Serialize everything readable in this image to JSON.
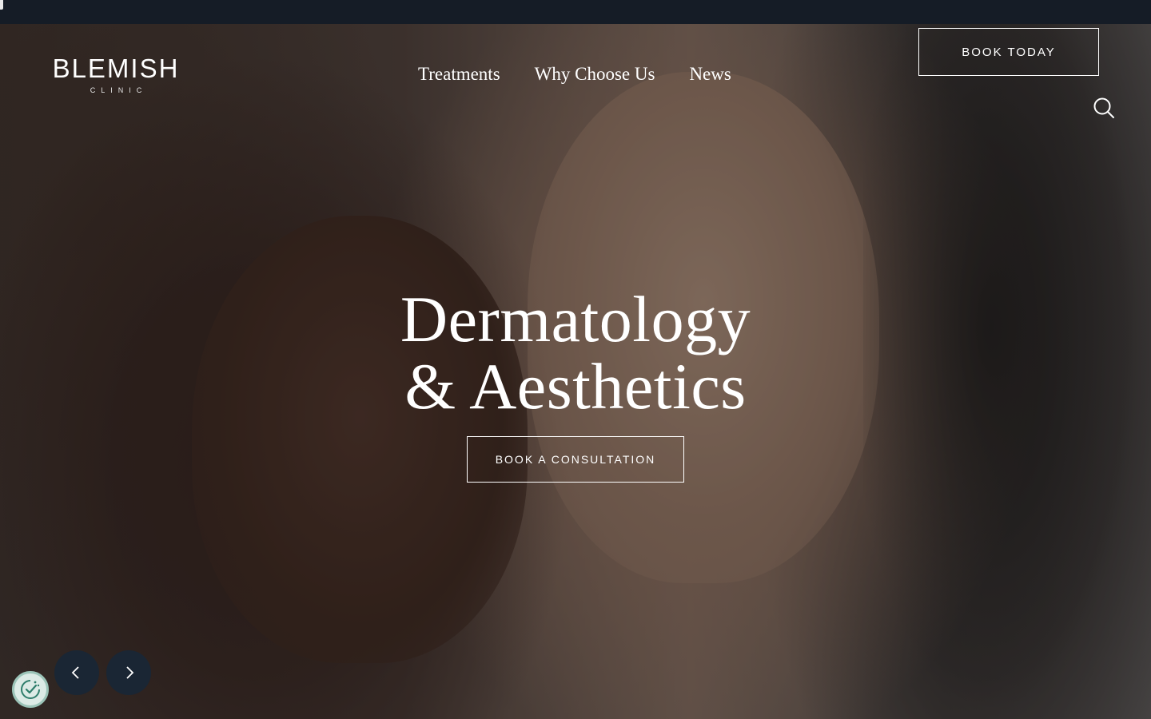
{
  "brand": {
    "name": "BLEMISH",
    "tagline": "CLINIC"
  },
  "nav": {
    "items": [
      {
        "label": "Treatments"
      },
      {
        "label": "Why Choose Us"
      },
      {
        "label": "News"
      }
    ]
  },
  "header": {
    "book_label": "BOOK TODAY",
    "search_icon": "search-icon"
  },
  "hero": {
    "headline_line1": "Dermatology",
    "headline_line2": "& Aesthetics",
    "cta_label": "BOOK A CONSULTATION",
    "prev_icon": "chevron-left-icon",
    "next_icon": "chevron-right-icon"
  },
  "cookie": {
    "icon": "cookie-consent-icon"
  },
  "colors": {
    "topbar": "#151c26",
    "slider_button": "#1a2634",
    "cookie_bg": "#dcebe6",
    "cookie_border": "#9bc4b8"
  }
}
